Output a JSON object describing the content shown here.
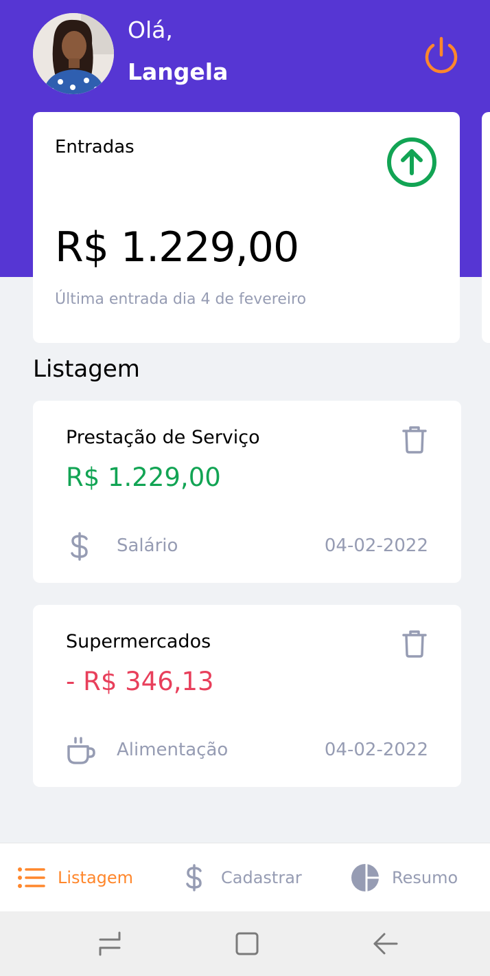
{
  "header": {
    "greeting": "Olá,",
    "username": "Langela"
  },
  "summary": {
    "title": "Entradas",
    "amount": "R$ 1.229,00",
    "subtitle": "Última entrada dia  4 de fevereiro"
  },
  "listing": {
    "title": "Listagem",
    "transactions": [
      {
        "title": "Prestação de Serviço",
        "amount": "R$ 1.229,00",
        "type": "income",
        "category": "Salário",
        "category_icon": "dollar-icon",
        "date": "04-02-2022"
      },
      {
        "title": "Supermercados",
        "amount": "- R$ 346,13",
        "type": "outcome",
        "category": "Alimentação",
        "category_icon": "coffee-icon",
        "date": "04-02-2022"
      }
    ]
  },
  "tabs": [
    {
      "label": "Listagem",
      "icon": "list-icon",
      "active": true
    },
    {
      "label": "Cadastrar",
      "icon": "dollar-icon",
      "active": false
    },
    {
      "label": "Resumo",
      "icon": "pie-chart-icon",
      "active": false
    }
  ],
  "colors": {
    "primary": "#5636d3",
    "accent": "#ff872c",
    "income": "#12a454",
    "outcome": "#e83f5b",
    "muted": "#969cb3",
    "background": "#f0f2f5"
  }
}
